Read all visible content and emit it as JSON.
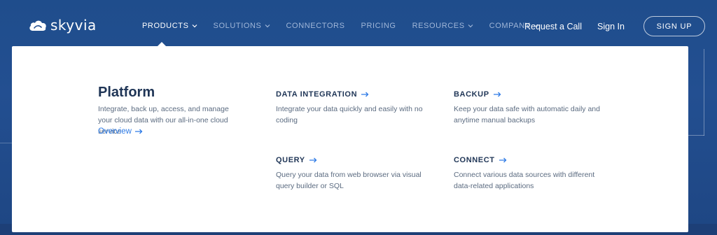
{
  "brand": {
    "name": "skyvia",
    "logo_icon": "cloud-icon"
  },
  "nav": {
    "items": [
      {
        "label": "PRODUCTS",
        "has_dropdown": true,
        "active": true
      },
      {
        "label": "SOLUTIONS",
        "has_dropdown": true,
        "active": false
      },
      {
        "label": "CONNECTORS",
        "has_dropdown": false,
        "active": false
      },
      {
        "label": "PRICING",
        "has_dropdown": false,
        "active": false
      },
      {
        "label": "RESOURCES",
        "has_dropdown": true,
        "active": false
      },
      {
        "label": "COMPANY",
        "has_dropdown": true,
        "active": false
      }
    ],
    "request_call": "Request a Call",
    "sign_in": "Sign In",
    "sign_up": "SIGN UP"
  },
  "menu": {
    "platform": {
      "title": "Platform",
      "description": "Integrate, back up, access, and manage your cloud data with our all-in-one cloud service",
      "link": "Overview"
    },
    "items": [
      {
        "title": "DATA INTEGRATION",
        "description": "Integrate your data quickly and easily with no coding"
      },
      {
        "title": "BACKUP",
        "description": "Keep your data safe with automatic daily and anytime manual backups"
      },
      {
        "title": "QUERY",
        "description": "Query your data from web browser via visual query builder or SQL"
      },
      {
        "title": "CONNECT",
        "description": "Connect various data sources with different data-related applications"
      }
    ]
  },
  "colors": {
    "background": "#234f91",
    "heading": "#1f3556",
    "body_text": "#5b6b80",
    "accent": "#2e7be6",
    "nav_inactive": "#9fb6d8"
  }
}
